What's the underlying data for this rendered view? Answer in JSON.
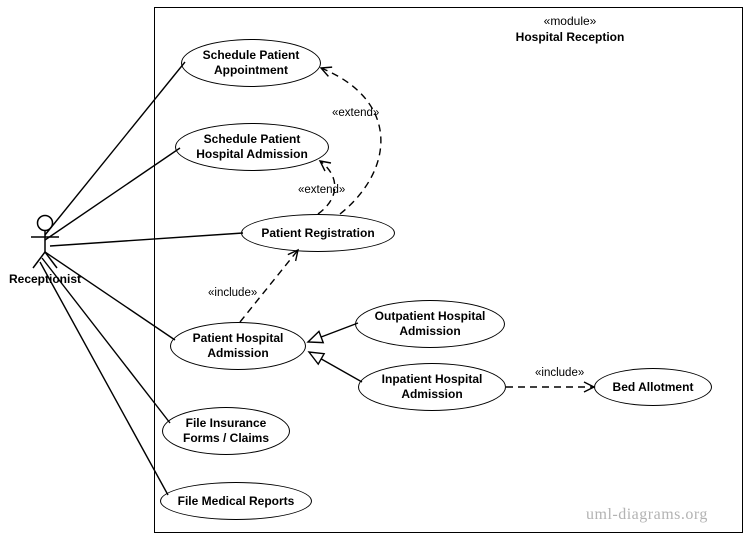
{
  "module": {
    "stereotype": "«module»",
    "name": "Hospital Reception"
  },
  "actor": {
    "name": "Receptionist"
  },
  "usecases": {
    "scheduleAppointment": "Schedule Patient\nAppointment",
    "scheduleAdmission": "Schedule Patient\nHospital Admission",
    "patientRegistration": "Patient Registration",
    "patientHospitalAdmission": "Patient Hospital\nAdmission",
    "outpatientAdmission": "Outpatient Hospital\nAdmission",
    "inpatientAdmission": "Inpatient Hospital\nAdmission",
    "bedAllotment": "Bed Allotment",
    "fileInsurance": "File Insurance\nForms / Claims",
    "fileMedicalReports": "File Medical Reports"
  },
  "labels": {
    "extend1": "«extend»",
    "extend2": "«extend»",
    "include1": "«include»",
    "include2": "«include»"
  },
  "watermark": "uml-diagrams.org"
}
